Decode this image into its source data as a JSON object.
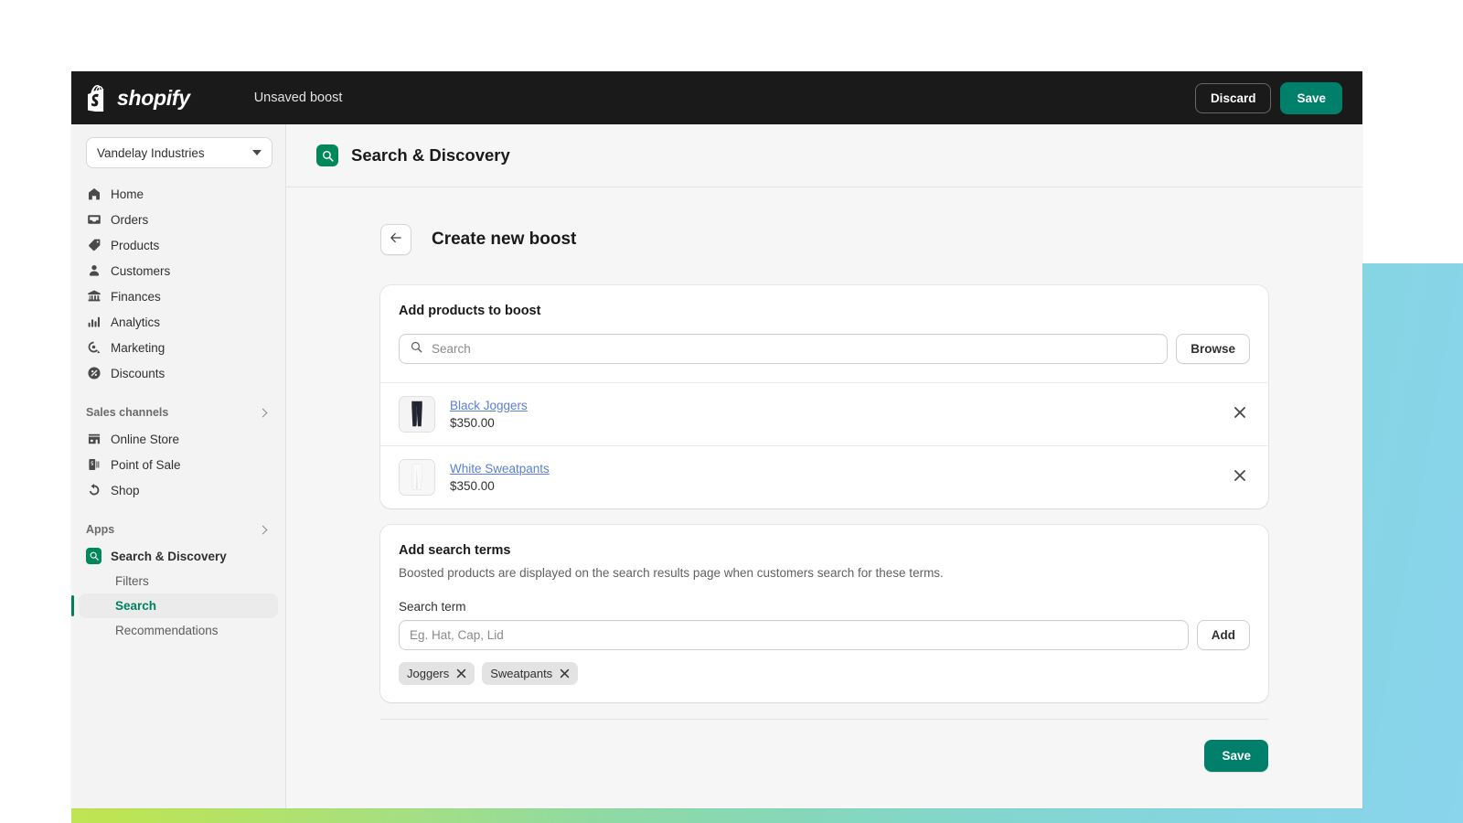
{
  "topbar": {
    "brand_name": "shopify",
    "brand_icon": "shopify-bag-icon",
    "title": "Unsaved boost",
    "discard_label": "Discard",
    "save_label": "Save"
  },
  "sidebar": {
    "store": {
      "name": "Vandelay Industries",
      "caret_icon": "chevron-down-icon"
    },
    "primary_items": [
      {
        "label": "Home",
        "icon": "home-icon"
      },
      {
        "label": "Orders",
        "icon": "orders-inbox-icon"
      },
      {
        "label": "Products",
        "icon": "product-tag-icon"
      },
      {
        "label": "Customers",
        "icon": "customer-person-icon"
      },
      {
        "label": "Finances",
        "icon": "bank-icon"
      },
      {
        "label": "Analytics",
        "icon": "bar-chart-icon"
      },
      {
        "label": "Marketing",
        "icon": "megaphone-target-icon"
      },
      {
        "label": "Discounts",
        "icon": "discount-percent-icon"
      }
    ],
    "sales_channels": {
      "label": "Sales channels",
      "chevron_icon": "chevron-right-icon",
      "items": [
        {
          "label": "Online Store",
          "icon": "storefront-icon"
        },
        {
          "label": "Point of Sale",
          "icon": "point-of-sale-icon"
        },
        {
          "label": "Shop",
          "icon": "shop-icon"
        }
      ]
    },
    "apps": {
      "label": "Apps",
      "chevron_icon": "chevron-right-icon",
      "app_name": "Search & Discovery",
      "app_icon": "search-discovery-icon",
      "sub_items": [
        {
          "label": "Filters",
          "selected": false
        },
        {
          "label": "Search",
          "selected": true
        },
        {
          "label": "Recommendations",
          "selected": false
        }
      ]
    }
  },
  "app_header": {
    "icon": "search-discovery-icon",
    "title": "Search & Discovery"
  },
  "page": {
    "back_icon": "arrow-left-icon",
    "title": "Create new boost"
  },
  "products_card": {
    "title": "Add products to boost",
    "search": {
      "icon": "search-icon",
      "placeholder": "Search",
      "value": ""
    },
    "browse_label": "Browse",
    "rows": [
      {
        "thumb": "black-joggers-thumbnail",
        "name": "Black Joggers",
        "price": "$350.00",
        "remove_icon": "close-icon"
      },
      {
        "thumb": "white-sweatpants-thumbnail",
        "name": "White Sweatpants",
        "price": "$350.00",
        "remove_icon": "close-icon"
      }
    ]
  },
  "terms_card": {
    "title": "Add search terms",
    "description": "Boosted products are displayed on the search results page when customers search for these terms.",
    "field_label": "Search term",
    "input": {
      "placeholder": "Eg. Hat, Cap, Lid",
      "value": ""
    },
    "add_label": "Add",
    "tags": [
      {
        "label": "Joggers",
        "remove_icon": "close-icon"
      },
      {
        "label": "Sweatpants",
        "remove_icon": "close-icon"
      }
    ]
  },
  "footer": {
    "save_label": "Save"
  },
  "colors": {
    "brand_green": "#00806a",
    "topbar_dark": "#1a1a1a",
    "selected_green": "#007f5f",
    "link_blue": "#5a7fd6"
  }
}
